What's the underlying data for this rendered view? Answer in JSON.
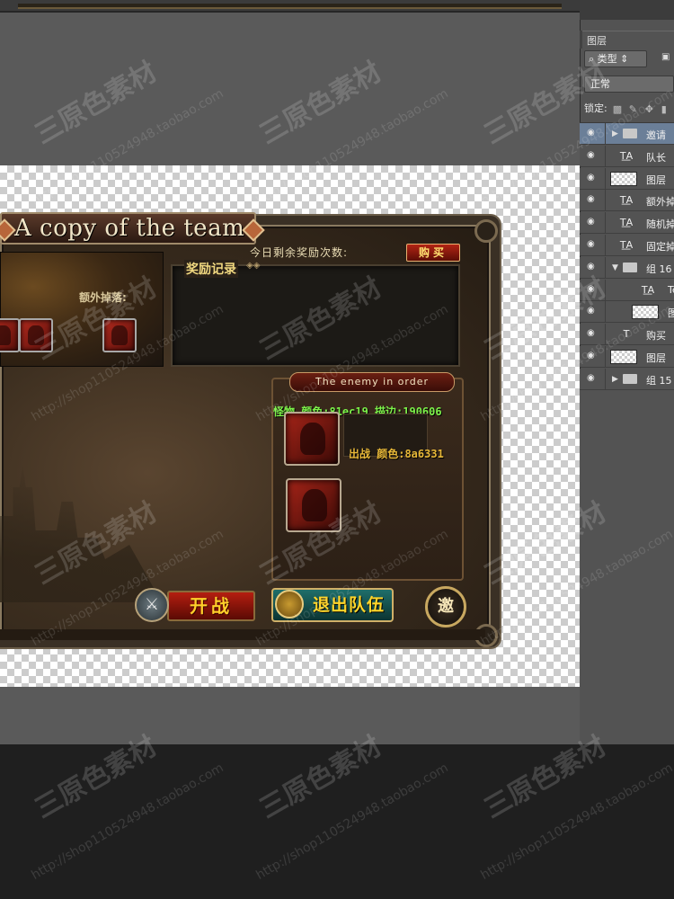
{
  "game": {
    "title": "A copy of the team",
    "extra_drop_label": "额外掉落:",
    "remaining_label": "今日剩余奖励次数:",
    "buy_label": "购买",
    "reward_label": "奖励记录",
    "reward_ornament": "◈◈",
    "enemy_banner": "The enemy in order",
    "monster_note": "怪物 颜色:81ec19 描边:190606",
    "battle_note": "出战 颜色:8a6331",
    "fight_label": "开战",
    "fight_icon": "⚔",
    "quit_label": "退出队伍",
    "invite_label": "邀"
  },
  "layers_panel": {
    "tab_label": "图层",
    "type_filter": "⌕ 类型 ⇕",
    "type_extra_icon": "▣",
    "blend_mode": "正常",
    "lock_label": "锁定:",
    "layers": [
      {
        "name": "邀请",
        "kind": "group",
        "expanded": false,
        "selected": true
      },
      {
        "name": "队长",
        "kind": "text-warp"
      },
      {
        "name": "图层",
        "kind": "pixel"
      },
      {
        "name": "额外掉",
        "kind": "text-warp"
      },
      {
        "name": "随机掉",
        "kind": "text-warp"
      },
      {
        "name": "固定掉",
        "kind": "text-warp"
      },
      {
        "name": "组 16",
        "kind": "group",
        "expanded": true
      },
      {
        "name": "Te",
        "kind": "text-warp",
        "indent": true
      },
      {
        "name": "图",
        "kind": "pixel",
        "indent": true
      },
      {
        "name": "购买",
        "kind": "text"
      },
      {
        "name": "图层",
        "kind": "pixel"
      },
      {
        "name": "组 15",
        "kind": "group",
        "expanded": false
      }
    ]
  },
  "watermark": {
    "brand": "三原色素材",
    "url": "http://shop110524948.taobao.com"
  },
  "colors": {
    "monster_text": "#81ec19",
    "battle_text": "#8a6331",
    "selected_layer": "#6b7f98"
  }
}
